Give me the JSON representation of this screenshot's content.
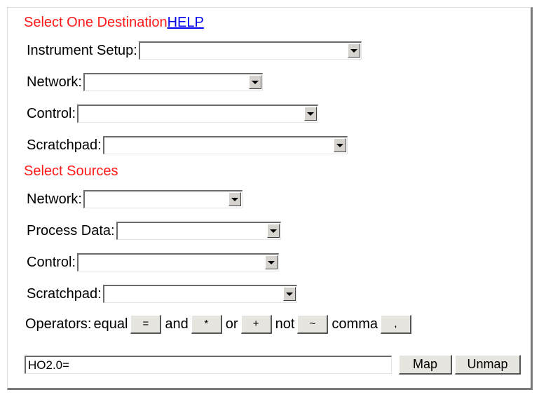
{
  "destination": {
    "title": "Select One Destination",
    "help_link": "HELP",
    "fields": [
      {
        "label": "Instrument Setup:",
        "value": ""
      },
      {
        "label": "Network:",
        "value": ""
      },
      {
        "label": "Control:",
        "value": ""
      },
      {
        "label": "Scratchpad:",
        "value": ""
      }
    ]
  },
  "sources": {
    "title": "Select Sources",
    "fields": [
      {
        "label": "Network:",
        "value": ""
      },
      {
        "label": "Process Data:",
        "value": ""
      },
      {
        "label": "Control:",
        "value": ""
      },
      {
        "label": "Scratchpad:",
        "value": ""
      }
    ]
  },
  "operators": {
    "label": "Operators:",
    "items": [
      {
        "name": "equal",
        "symbol": "="
      },
      {
        "name": "and",
        "symbol": "*"
      },
      {
        "name": "or",
        "symbol": "+"
      },
      {
        "name": "not",
        "symbol": "~"
      },
      {
        "name": "comma",
        "symbol": ","
      }
    ]
  },
  "expression": {
    "value": "HO2.0="
  },
  "buttons": {
    "map": "Map",
    "unmap": "Unmap"
  }
}
